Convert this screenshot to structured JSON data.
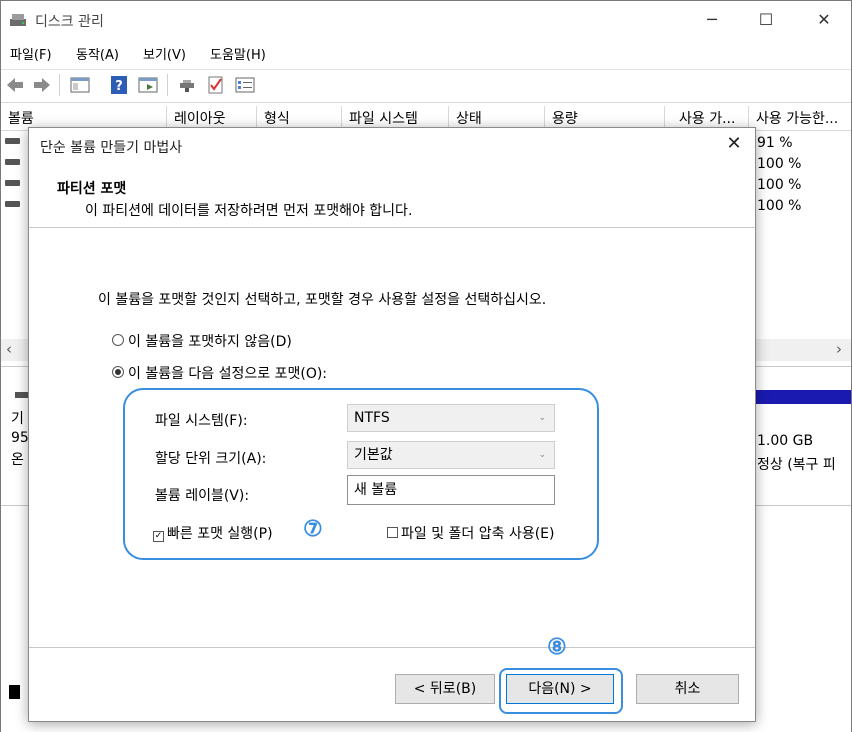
{
  "window": {
    "title": "디스크 관리",
    "controls": {
      "minimize": "─",
      "maximize": "☐",
      "close": "✕"
    }
  },
  "menu": [
    "파일(F)",
    "동작(A)",
    "보기(V)",
    "도움말(H)"
  ],
  "toolbar_icons": [
    "back-arrow-icon",
    "forward-arrow-icon",
    "console-tree-icon",
    "help-icon",
    "action-pane-icon",
    "connect-drive-icon",
    "check-icon",
    "properties-icon"
  ],
  "volume_list": {
    "columns": [
      "볼륨",
      "레이아웃",
      "형식",
      "파일 시스템",
      "상태",
      "용량",
      "사용 가...",
      "사용 가능한..."
    ],
    "visible_percent_free": [
      "91 %",
      "100 %",
      "100 %",
      "100 %"
    ]
  },
  "lower_pane": {
    "fragments": [
      "기",
      "95",
      "온",
      "1.00 GB",
      "정상 (복구 피"
    ]
  },
  "scroll": {
    "left": "‹",
    "right": "›"
  },
  "wizard": {
    "title": "단순 볼륨 만들기 마법사",
    "close": "✕",
    "heading": "파티션 포맷",
    "subheading": "이 파티션에 데이터를 저장하려면 먼저 포맷해야 합니다.",
    "instruction": "이 볼륨을 포맷할 것인지 선택하고, 포맷할 경우 사용할 설정을 선택하십시오.",
    "radio_no_format": "이 볼륨을 포맷하지 않음(D)",
    "radio_format": "이 볼륨을 다음 설정으로 포맷(O):",
    "selected_option": "format",
    "file_system_label": "파일 시스템(F):",
    "file_system_value": "NTFS",
    "allocation_label": "할당 단위 크기(A):",
    "allocation_value": "기본값",
    "volume_label_label": "볼륨 레이블(V):",
    "volume_label_value": "새 볼륨",
    "quick_format_label": "빠른 포맷 실행(P)",
    "quick_format_checked": true,
    "compression_label": "파일 및 폴더 압축 사용(E)",
    "compression_checked": false,
    "buttons": {
      "back": "< 뒤로(B)",
      "next": "다음(N) >",
      "cancel": "취소"
    }
  },
  "annotations": {
    "step7": "⑦",
    "step8": "⑧",
    "accent_color": "#3a8ee0"
  }
}
